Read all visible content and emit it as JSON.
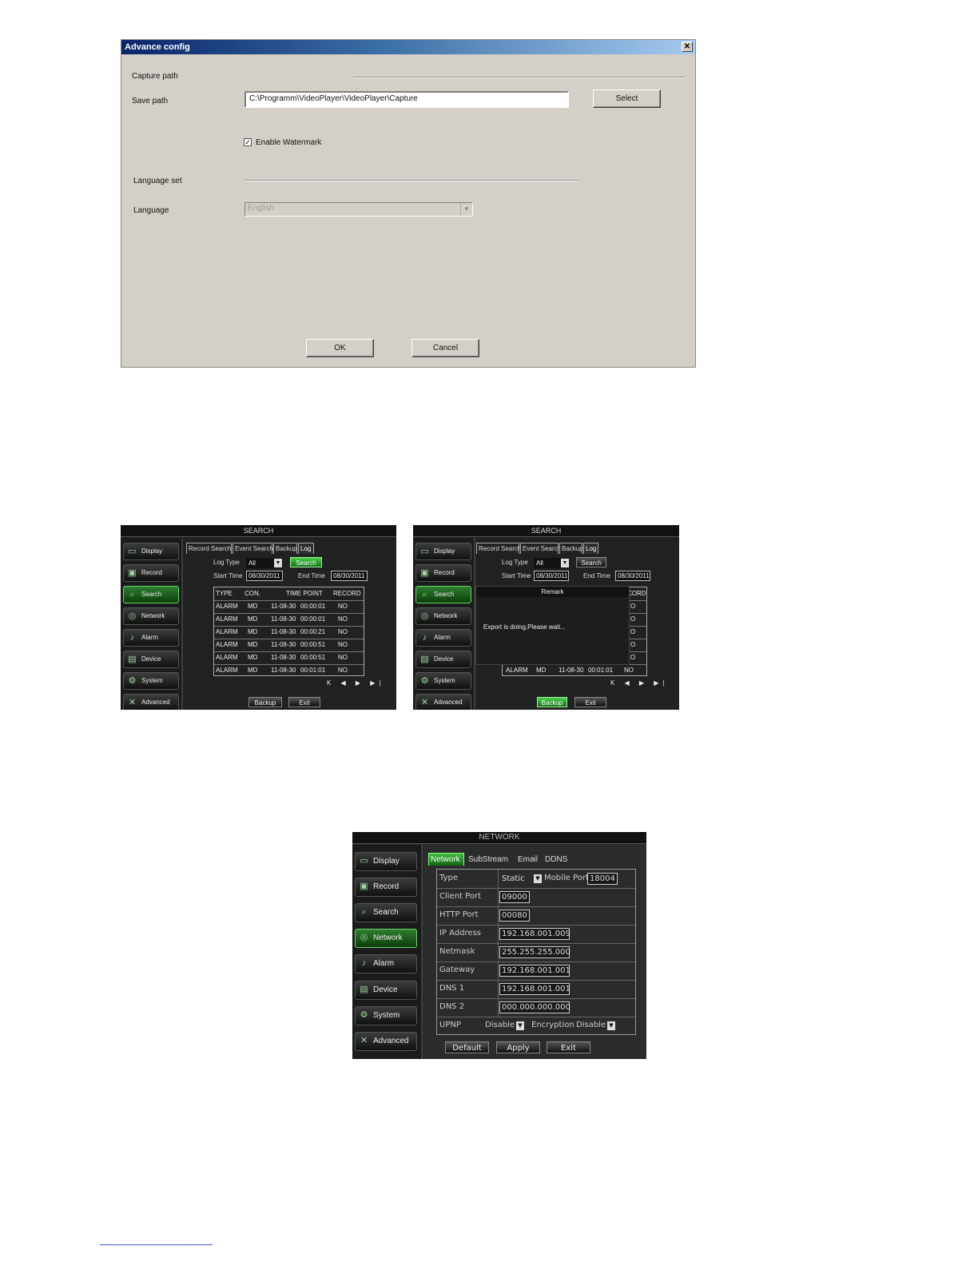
{
  "advance_config": {
    "title": "Advance config",
    "close_glyph": "✕",
    "capture_path_label": "Capture path",
    "save_path_label": "Save path",
    "save_path_value": "C:\\Programm\\VideoPlayer\\VideoPlayer\\Capture",
    "select_label": "Select",
    "watermark_label": "Enable Watermark",
    "watermark_checked": true,
    "language_set_label": "Language set",
    "language_label": "Language",
    "language_value": "English",
    "ok_label": "OK",
    "cancel_label": "Cancel"
  },
  "sidebar_items": [
    "Display",
    "Record",
    "Search",
    "Network",
    "Alarm",
    "Device",
    "System",
    "Advanced"
  ],
  "search_left": {
    "title": "SEARCH",
    "tabs": [
      "Record Search",
      "Event Search",
      "Backup",
      "Log"
    ],
    "log_type_label": "Log Type",
    "log_type_value": "All",
    "search_button": "Search",
    "start_time_label": "Start Time",
    "start_time_value": "08/30/2011",
    "end_time_label": "End Time",
    "end_time_value": "08/30/2011",
    "columns": [
      "TYPE",
      "CON.",
      "TIME POINT",
      "RECORD"
    ],
    "rows": [
      [
        "ALARM",
        "MD",
        "11-08-30",
        "00:00:01",
        "NO"
      ],
      [
        "ALARM",
        "MD",
        "11-08-30",
        "00:00:01",
        "NO"
      ],
      [
        "ALARM",
        "MD",
        "11-08-30",
        "00:00:21",
        "NO"
      ],
      [
        "ALARM",
        "MD",
        "11-08-30",
        "00:00:51",
        "NO"
      ],
      [
        "ALARM",
        "MD",
        "11-08-30",
        "00:00:51",
        "NO"
      ],
      [
        "ALARM",
        "MD",
        "11-08-30",
        "00:01:01",
        "NO"
      ]
    ],
    "pager": "K ◀ ▶ ▶|",
    "backup_button": "Backup",
    "exit_button": "Exit"
  },
  "search_right": {
    "title": "SEARCH",
    "tabs": [
      "Record Search",
      "Event Search",
      "Backup",
      "Log"
    ],
    "log_type_label": "Log Type",
    "log_type_value": "All",
    "search_button": "Search",
    "start_time_label": "Start Time",
    "start_time_value": "08/30/2011",
    "end_time_label": "End Time",
    "end_time_value": "08/30/2011",
    "remark_title": "Remark",
    "remark_text": "Export is doing,Please wait...",
    "partial_col": "CORD",
    "partial_cells": [
      "O",
      "O",
      "O",
      "O",
      "O"
    ],
    "last_row": [
      "ALARM",
      "MD",
      "11-08-30",
      "00:01:01",
      "NO"
    ],
    "pager": "K ◀ ▶ ▶|",
    "backup_button": "Backup",
    "exit_button": "Exit"
  },
  "network": {
    "title": "NETWORK",
    "tabs": [
      "Network",
      "SubStream",
      "Email",
      "DDNS"
    ],
    "type_label": "Type",
    "type_value": "Static",
    "mobile_port_label": "Mobile Port",
    "mobile_port_value": "18004",
    "rows": [
      {
        "label": "Client Port",
        "value": "09000"
      },
      {
        "label": "HTTP Port",
        "value": "00080"
      },
      {
        "label": "IP Address",
        "value": "192.168.001.009"
      },
      {
        "label": "Netmask",
        "value": "255.255.255.000"
      },
      {
        "label": "Gateway",
        "value": "192.168.001.001"
      },
      {
        "label": "DNS 1",
        "value": "192.168.001.001"
      },
      {
        "label": "DNS 2",
        "value": "000.000.000.000"
      }
    ],
    "upnp_label": "UPNP",
    "upnp_value": "Disable",
    "encryption_label": "Encryption",
    "encryption_value": "Disable",
    "default_button": "Default",
    "apply_button": "Apply",
    "exit_button": "Exit"
  },
  "colors": {
    "active_green": "#2f7d2f",
    "dialog_gray": "#d4d0c8",
    "title_blue": "#0a246a"
  }
}
